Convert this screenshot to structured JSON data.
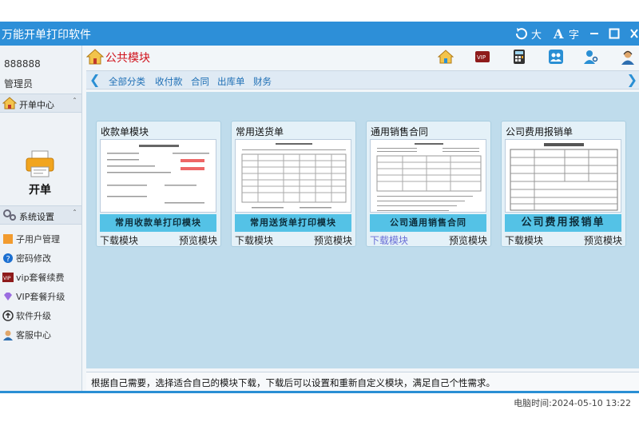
{
  "window": {
    "title": "万能开单打印软件",
    "font_large_label": "大",
    "font_char_label": "字"
  },
  "sidebar": {
    "user_id": "888888",
    "user_role": "管理员",
    "section_billing": "开单中心",
    "big_button_label": "开单",
    "section_settings": "系统设置",
    "menu": [
      {
        "label": "子用户管理",
        "icon": "users-icon"
      },
      {
        "label": "密码修改",
        "icon": "question-icon"
      },
      {
        "label": "vip套餐续费",
        "icon": "vip-icon"
      },
      {
        "label": "VIP套餐升级",
        "icon": "diamond-icon"
      },
      {
        "label": "软件升级",
        "icon": "upgrade-icon"
      },
      {
        "label": "客服中心",
        "icon": "support-icon"
      }
    ]
  },
  "main": {
    "title": "公共模块",
    "filters": [
      "全部分类",
      "收付款",
      "合同",
      "出库单",
      "财务"
    ],
    "cards": [
      {
        "title": "收款单模块",
        "banner": "常用收款单打印模块",
        "download": "下载模块",
        "preview": "预览模块",
        "download_active": false
      },
      {
        "title": "常用送货单",
        "banner": "常用送货单打印模块",
        "download": "下载模块",
        "preview": "预览模块",
        "download_active": false
      },
      {
        "title": "通用销售合同",
        "banner": "公司通用销售合同",
        "download": "下载模块",
        "preview": "预览模块",
        "download_active": true
      },
      {
        "title": "公司费用报销单",
        "banner": "公司费用报销单",
        "download": "下载模块",
        "preview": "预览模块",
        "download_active": false
      }
    ],
    "tip": "根据自己需要，选择适合自己的模块下载，下载后可以设置和重新自定义模块，满足自己个性需求。"
  },
  "status": {
    "time": "电脑时间:2024-05-10 13:22"
  },
  "colors": {
    "titlebar": "#2d8fd8",
    "accent_red": "#d0121b",
    "banner": "#54c2e6",
    "link_active": "#6a6fd6"
  }
}
